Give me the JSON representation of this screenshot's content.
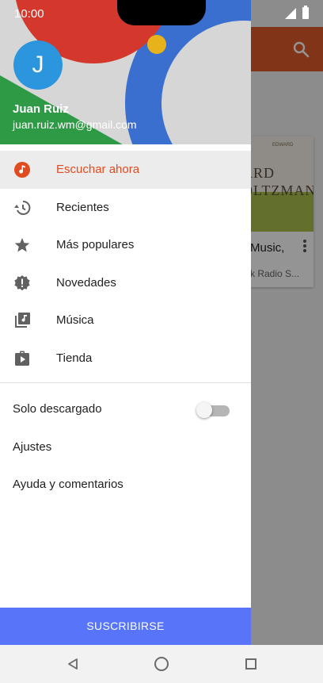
{
  "status_bar": {
    "time": "10:00"
  },
  "user": {
    "initial": "J",
    "name": "Juan Ruiz",
    "email": "juan.ruiz.wm@gmail.com"
  },
  "menu": {
    "items": [
      {
        "label": "Escuchar ahora",
        "icon": "listen-now-icon",
        "active": true
      },
      {
        "label": "Recientes",
        "icon": "history-icon",
        "active": false
      },
      {
        "label": "Más populares",
        "icon": "star-icon",
        "active": false
      },
      {
        "label": "Novedades",
        "icon": "new-badge-icon",
        "active": false
      },
      {
        "label": "Música",
        "icon": "music-library-icon",
        "active": false
      },
      {
        "label": "Tienda",
        "icon": "store-icon",
        "active": false
      }
    ]
  },
  "settings": {
    "downloaded_only_label": "Solo descargado",
    "downloaded_only_on": false,
    "settings_label": "Ajustes",
    "help_label": "Ayuda y comentarios"
  },
  "subscribe_label": "SUSCRIBIRSE",
  "background_card": {
    "art_line_top": "EDWARD",
    "art_line_1": "ARD",
    "art_line_2": "OLTZMAN",
    "title": "Music,",
    "subtitle": "k Radio S..."
  },
  "colors": {
    "accent": "#e14b20",
    "app_bar": "#e05a2b",
    "subscribe": "#5874f8",
    "avatar": "#2b96dd"
  }
}
